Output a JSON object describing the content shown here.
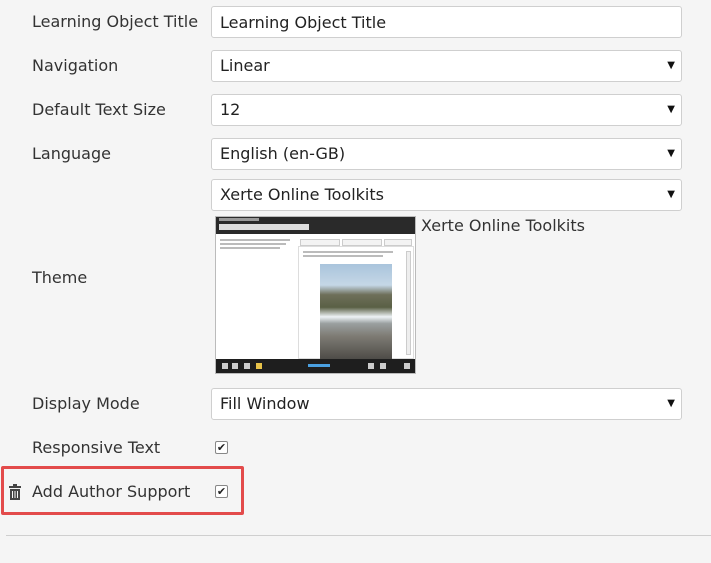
{
  "fields": {
    "title": {
      "label": "Learning Object Title",
      "value": "Learning Object Title"
    },
    "navigation": {
      "label": "Navigation",
      "value": "Linear"
    },
    "text_size": {
      "label": "Default Text Size",
      "value": "12"
    },
    "language": {
      "label": "Language",
      "value": "English (en-GB)"
    },
    "theme": {
      "label": "Theme",
      "value": "Xerte Online Toolkits",
      "preview_name": "Xerte Online Toolkits"
    },
    "display_mode": {
      "label": "Display Mode",
      "value": "Fill Window"
    },
    "responsive_text": {
      "label": "Responsive Text",
      "checked": true,
      "check_glyph": "✔"
    },
    "author_support": {
      "label": "Add Author Support",
      "checked": true,
      "check_glyph": "✔"
    }
  },
  "icons": {
    "select_arrow": "▼",
    "delete": "trash-icon"
  },
  "colors": {
    "highlight": "#e34b4b",
    "background": "#f5f5f5"
  }
}
